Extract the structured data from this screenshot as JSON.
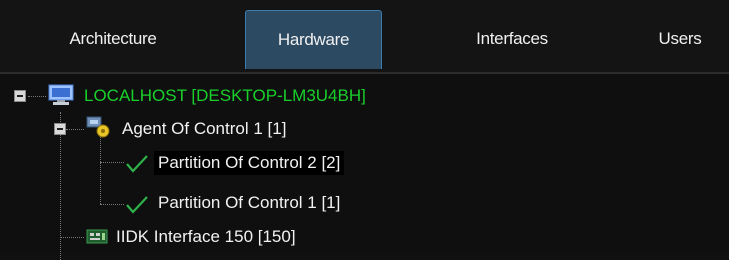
{
  "tabs": [
    {
      "label": "Architecture",
      "active": false
    },
    {
      "label": "Hardware",
      "active": true
    },
    {
      "label": "Interfaces",
      "active": false
    },
    {
      "label": "Users",
      "active": false
    }
  ],
  "tree": {
    "root": {
      "label": "LOCALHOST [DESKTOP-LM3U4BH]",
      "icon": "computer-icon",
      "color": "#19d02b"
    },
    "agent": {
      "label": "Agent Of Control 1 [1]",
      "icon": "agent-icon"
    },
    "partitions": [
      {
        "label": "Partition Of Control 2 [2]",
        "icon": "checkmark-icon",
        "selected": true
      },
      {
        "label": "Partition Of Control 1 [1]",
        "icon": "checkmark-icon",
        "selected": false
      }
    ],
    "interface": {
      "label": "IIDK Interface 150 [150]",
      "icon": "interface-board-icon"
    }
  }
}
